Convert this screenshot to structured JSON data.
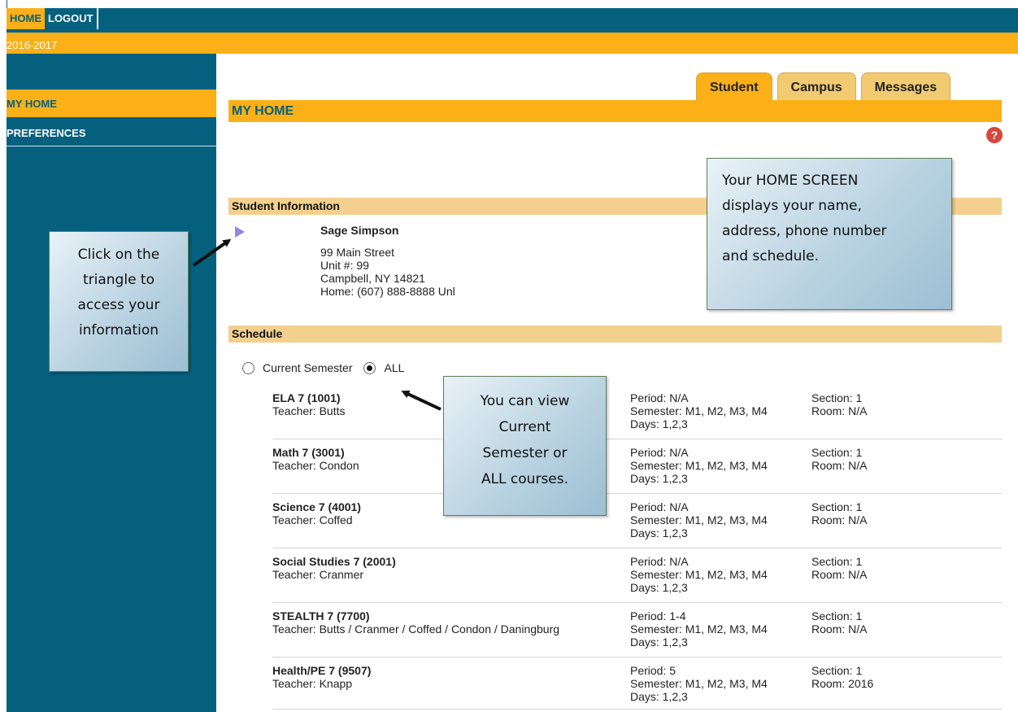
{
  "topnav": {
    "home": "HOME",
    "logout": "LOGOUT"
  },
  "year": "2016-2017",
  "sidebar": {
    "items": [
      {
        "label": "MY HOME"
      },
      {
        "label": "PREFERENCES"
      }
    ]
  },
  "tabs": [
    {
      "label": "Student"
    },
    {
      "label": "Campus"
    },
    {
      "label": "Messages"
    }
  ],
  "page_title": "MY HOME",
  "help_icon": "?",
  "student_info": {
    "header": "Student Information",
    "name": "Sage Simpson",
    "address1": "99 Main Street",
    "unit": "Unit #: 99",
    "city": "Campbell, NY 14821",
    "phone": "Home: (607) 888-8888 Unl"
  },
  "schedule": {
    "header": "Schedule",
    "filter": {
      "current_label": "Current Semester",
      "all_label": "ALL",
      "selected": "ALL"
    },
    "courses": [
      {
        "name": "ELA 7 (1001)",
        "teacher": "Teacher: Butts",
        "period": "Period: N/A",
        "semester": "Semester: M1, M2, M3, M4",
        "days": "Days: 1,2,3",
        "section": "Section: 1",
        "room": "Room: N/A"
      },
      {
        "name": "Math 7 (3001)",
        "teacher": "Teacher: Condon",
        "period": "Period: N/A",
        "semester": "Semester: M1, M2, M3, M4",
        "days": "Days: 1,2,3",
        "section": "Section: 1",
        "room": "Room: N/A"
      },
      {
        "name": "Science 7 (4001)",
        "teacher": "Teacher: Coffed",
        "period": "Period: N/A",
        "semester": "Semester: M1, M2, M3, M4",
        "days": "Days: 1,2,3",
        "section": "Section: 1",
        "room": "Room: N/A"
      },
      {
        "name": "Social Studies 7 (2001)",
        "teacher": "Teacher: Cranmer",
        "period": "Period: N/A",
        "semester": "Semester: M1, M2, M3, M4",
        "days": "Days: 1,2,3",
        "section": "Section: 1",
        "room": "Room: N/A"
      },
      {
        "name": "STEALTH 7 (7700)",
        "teacher": "Teacher: Butts / Cranmer / Coffed / Condon / Daningburg",
        "period": "Period: 1-4",
        "semester": "Semester: M1, M2, M3, M4",
        "days": "Days: 1,2,3",
        "section": "Section: 1",
        "room": "Room: N/A"
      },
      {
        "name": "Health/PE 7 (9507)",
        "teacher": "Teacher: Knapp",
        "period": "Period: 5",
        "semester": "Semester: M1, M2, M3, M4",
        "days": "Days: 1,2,3",
        "section": "Section: 1",
        "room": "Room: 2016"
      }
    ]
  },
  "callouts": {
    "left": [
      "Click on the",
      "triangle to",
      "access your",
      "information"
    ],
    "right": [
      "Your HOME SCREEN",
      "displays your name,",
      "address, phone number",
      "and schedule."
    ],
    "mid": [
      "You can view",
      "Current",
      "Semester or",
      "ALL courses."
    ]
  },
  "colors": {
    "brand": "#05607e",
    "accent": "#fbb017",
    "section": "#f3d08e"
  }
}
